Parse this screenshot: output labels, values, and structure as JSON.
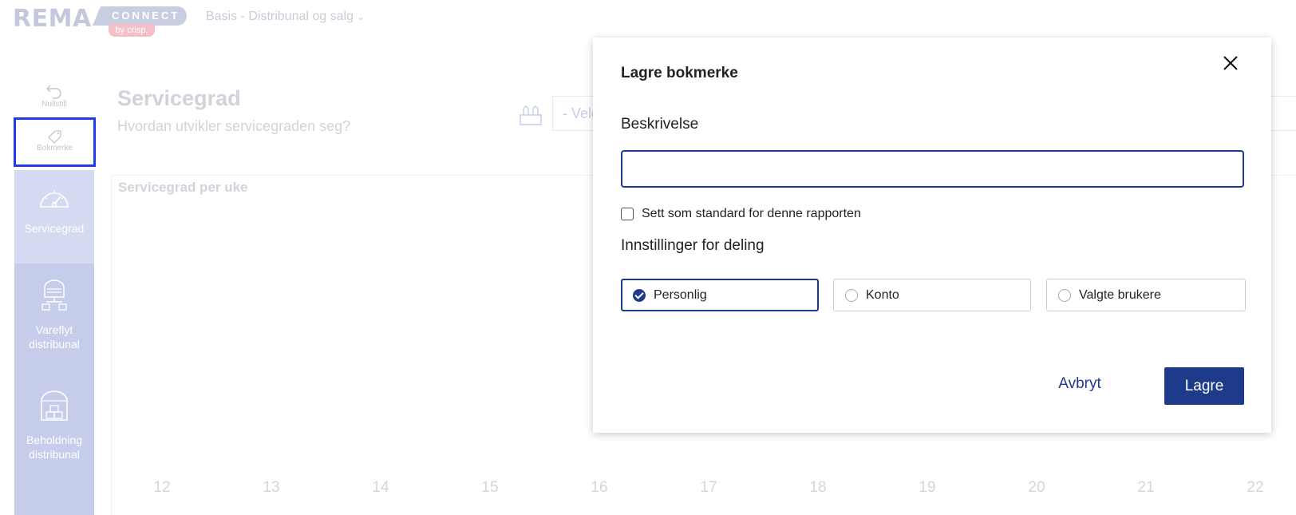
{
  "header": {
    "logo_main": "REMA",
    "logo_connect": "CONNECT",
    "logo_by": "by crisp.",
    "context_selector": "Basis - Distribunal og salg"
  },
  "sidebar": {
    "tools": [
      {
        "label": "Nullstill",
        "icon": "undo-icon"
      },
      {
        "label": "Bokmerke",
        "icon": "bookmark-tag-icon"
      }
    ],
    "nav": [
      {
        "label": "Servicegrad",
        "icon": "speedometer-icon"
      },
      {
        "label": "Vareflyt distribunal",
        "icon": "warehouse-flow-icon"
      },
      {
        "label": "Beholdning distribunal",
        "icon": "warehouse-stock-icon"
      }
    ]
  },
  "page": {
    "title": "Servicegrad",
    "subtitle": "Hvordan utvikler servicegraden seg?",
    "filter_placeholder": "- Velg"
  },
  "chart": {
    "title": "Servicegrad per uke",
    "x_ticks": [
      "12",
      "13",
      "14",
      "15",
      "16",
      "17",
      "18",
      "19",
      "20",
      "21",
      "22"
    ]
  },
  "modal": {
    "title": "Lagre bokmerke",
    "description_label": "Beskrivelse",
    "description_value": "",
    "default_checkbox_label": "Sett som standard for denne rapporten",
    "default_checked": false,
    "sharing_label": "Innstillinger for deling",
    "sharing_options": [
      {
        "label": "Personlig",
        "selected": true
      },
      {
        "label": "Konto",
        "selected": false
      },
      {
        "label": "Valgte brukere",
        "selected": false
      }
    ],
    "cancel_label": "Avbryt",
    "save_label": "Lagre"
  },
  "colors": {
    "primary": "#1e3a8a",
    "highlight_border": "#1f3bea",
    "nav_background": "#c6cdeb"
  }
}
